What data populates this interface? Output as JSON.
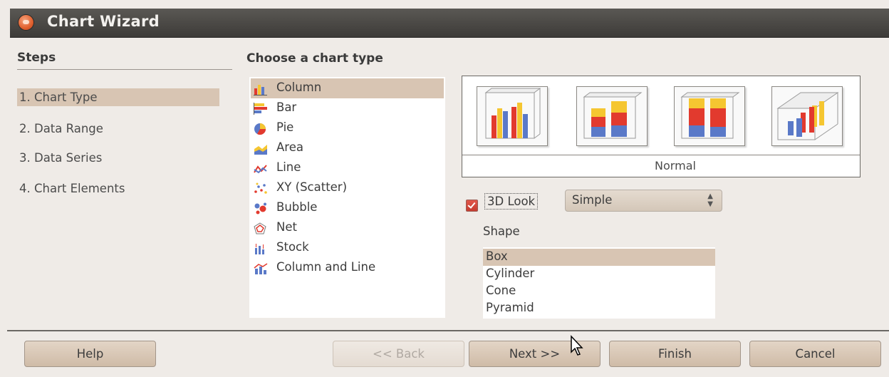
{
  "window": {
    "title": "Chart Wizard",
    "close_icon": "close-circle-icon"
  },
  "steps": {
    "heading": "Steps",
    "items": [
      {
        "label": "1. Chart Type",
        "selected": true
      },
      {
        "label": "2. Data Range",
        "selected": false
      },
      {
        "label": "3. Data Series",
        "selected": false
      },
      {
        "label": "4. Chart Elements",
        "selected": false
      }
    ]
  },
  "main": {
    "heading": "Choose a chart type",
    "chart_types": [
      {
        "label": "Column",
        "icon": "column-chart-icon",
        "selected": true
      },
      {
        "label": "Bar",
        "icon": "bar-chart-icon",
        "selected": false
      },
      {
        "label": "Pie",
        "icon": "pie-chart-icon",
        "selected": false
      },
      {
        "label": "Area",
        "icon": "area-chart-icon",
        "selected": false
      },
      {
        "label": "Line",
        "icon": "line-chart-icon",
        "selected": false
      },
      {
        "label": "XY (Scatter)",
        "icon": "scatter-chart-icon",
        "selected": false
      },
      {
        "label": "Bubble",
        "icon": "bubble-chart-icon",
        "selected": false
      },
      {
        "label": "Net",
        "icon": "net-chart-icon",
        "selected": false
      },
      {
        "label": "Stock",
        "icon": "stock-chart-icon",
        "selected": false
      },
      {
        "label": "Column and Line",
        "icon": "column-line-chart-icon",
        "selected": false
      }
    ],
    "variant_label": "Normal",
    "variants": [
      {
        "icon": "normal-column-icon",
        "selected": true
      },
      {
        "icon": "stacked-column-icon",
        "selected": false
      },
      {
        "icon": "percent-stacked-column-icon",
        "selected": false
      },
      {
        "icon": "deep-column-icon",
        "selected": false
      }
    ],
    "look3d": {
      "label": "3D Look",
      "checked": true
    },
    "look_combo": {
      "value": "Simple"
    },
    "shape": {
      "label": "Shape",
      "options": [
        {
          "label": "Box",
          "selected": true
        },
        {
          "label": "Cylinder",
          "selected": false
        },
        {
          "label": "Cone",
          "selected": false
        },
        {
          "label": "Pyramid",
          "selected": false
        }
      ]
    }
  },
  "buttons": {
    "help": "Help",
    "back": "<< Back",
    "next": "Next >>",
    "finish": "Finish",
    "cancel": "Cancel"
  },
  "colors": {
    "selection": "#d8c5b3",
    "titlebar": "#4a4845",
    "accent": "#e0602e",
    "bar_red": "#e23a2e",
    "bar_yellow": "#f5c631",
    "bar_blue": "#5a79c8"
  }
}
